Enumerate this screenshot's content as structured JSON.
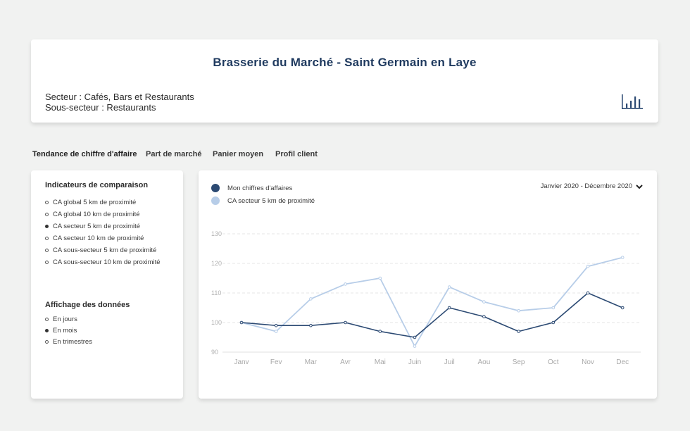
{
  "header": {
    "title": "Brasserie du Marché - Saint Germain en Laye",
    "sector": "Secteur : Cafés, Bars et Restaurants",
    "subsector": "Sous-secteur :  Restaurants",
    "chart_icon": "bar-chart-icon"
  },
  "tabs": [
    {
      "label": "Tendance de chiffre d'affaire",
      "active": true
    },
    {
      "label": "Part de marché",
      "active": false
    },
    {
      "label": "Panier moyen",
      "active": false
    },
    {
      "label": "Profil client",
      "active": false
    }
  ],
  "left_panel": {
    "comparison_title": "Indicateurs de comparaison",
    "comparison_options": [
      {
        "label": "CA global 5 km de proximité",
        "selected": false
      },
      {
        "label": "CA global 10 km de proximité",
        "selected": false
      },
      {
        "label": "CA secteur 5 km de proximité",
        "selected": true
      },
      {
        "label": "CA secteur 10 km de proximité",
        "selected": false
      },
      {
        "label": "CA sous-secteur 5 km de proximité",
        "selected": false
      },
      {
        "label": "CA sous-secteur 10 km de proximité",
        "selected": false
      }
    ],
    "display_title": "Affichage des données",
    "display_options": [
      {
        "label": "En jours",
        "selected": false
      },
      {
        "label": "En mois",
        "selected": true
      },
      {
        "label": "En trimestres",
        "selected": false
      }
    ]
  },
  "chart_panel": {
    "date_range": "Janvier 2020 - Décembre 2020",
    "date_range_icon": "chevron-down-icon"
  },
  "colors": {
    "primary": "#2c4a73",
    "secondary": "#b7cde8",
    "title": "#1f3a5f"
  },
  "chart_data": {
    "type": "line",
    "categories": [
      "Janv",
      "Fev",
      "Mar",
      "Avr",
      "Mai",
      "Juin",
      "Juil",
      "Aou",
      "Sep",
      "Oct",
      "Nov",
      "Dec"
    ],
    "series": [
      {
        "name": "Mon chiffres d'affaires",
        "color": "#2c4a73",
        "values": [
          100,
          99,
          99,
          100,
          97,
          95,
          105,
          102,
          97,
          100,
          110,
          105
        ]
      },
      {
        "name": "CA secteur 5 km de proximité",
        "color": "#b7cde8",
        "values": [
          100,
          97,
          108,
          113,
          115,
          92,
          112,
          107,
          104,
          105,
          119,
          122
        ]
      }
    ],
    "ylim": [
      90,
      130
    ],
    "yticks": [
      90,
      100,
      110,
      120,
      130
    ],
    "grid": true,
    "legend_position": "top-left"
  }
}
